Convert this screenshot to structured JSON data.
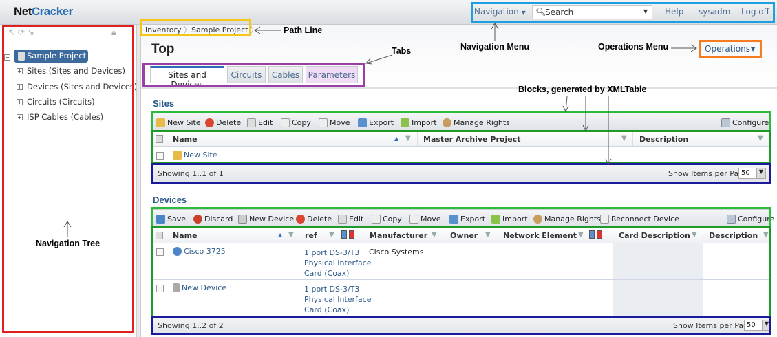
{
  "header": {
    "logo_part1": "Net",
    "logo_part2": "Cracker",
    "navigation": "Navigation",
    "search_placeholder": "Search",
    "help": "Help",
    "user": "sysadm",
    "logoff": "Log off"
  },
  "tree": {
    "root": "Sample Project",
    "items": [
      "Sites (Sites and Devices)",
      "Devices (Sites and Devices)",
      "Circuits (Circuits)",
      "ISP Cables (Cables)"
    ]
  },
  "breadcrumb": [
    "Inventory",
    "Sample Project"
  ],
  "page_title": "Top",
  "operations": "Operations",
  "tabs": [
    "Sites and Devices",
    "Circuits",
    "Cables",
    "Parameters"
  ],
  "sites": {
    "heading": "Sites",
    "toolbar": [
      "New Site",
      "Delete",
      "Edit",
      "Copy",
      "Move",
      "Export",
      "Import",
      "Manage Rights"
    ],
    "configure": "Configure",
    "columns": [
      "Name",
      "Master Archive Project",
      "Description"
    ],
    "rows": [
      {
        "name": "New Site"
      }
    ],
    "showing": "Showing 1..1 of 1",
    "per_page_label": "Show Items per Page:",
    "per_page": "50"
  },
  "devices": {
    "heading": "Devices",
    "toolbar": [
      "Save",
      "Discard",
      "New Device",
      "Delete",
      "Edit",
      "Copy",
      "Move",
      "Export",
      "Import",
      "Manage Rights",
      "Reconnect Device"
    ],
    "configure": "Configure",
    "columns": [
      "Name",
      "ref",
      "Manufacturer",
      "Owner",
      "Network Element",
      "Card Description",
      "Description"
    ],
    "rows": [
      {
        "name": "Cisco 3725",
        "ref": [
          "1 port DS-3/T3",
          "Physical Interface",
          "Card (Coax)"
        ],
        "manufacturer": "Cisco Systems"
      },
      {
        "name": "New Device",
        "ref": [
          "1 port DS-3/T3",
          "Physical Interface",
          "Card (Coax)"
        ],
        "manufacturer": ""
      }
    ],
    "showing": "Showing 1..2 of 2",
    "per_page_label": "Show Items per Page:",
    "per_page": "50"
  },
  "annotations": {
    "path_line": "Path Line",
    "tabs": "Tabs",
    "navigation_menu": "Navigation Menu",
    "operations_menu": "Operations Menu",
    "blocks": "Blocks, generated by XMLTable",
    "navigation_tree": "Navigation Tree"
  }
}
